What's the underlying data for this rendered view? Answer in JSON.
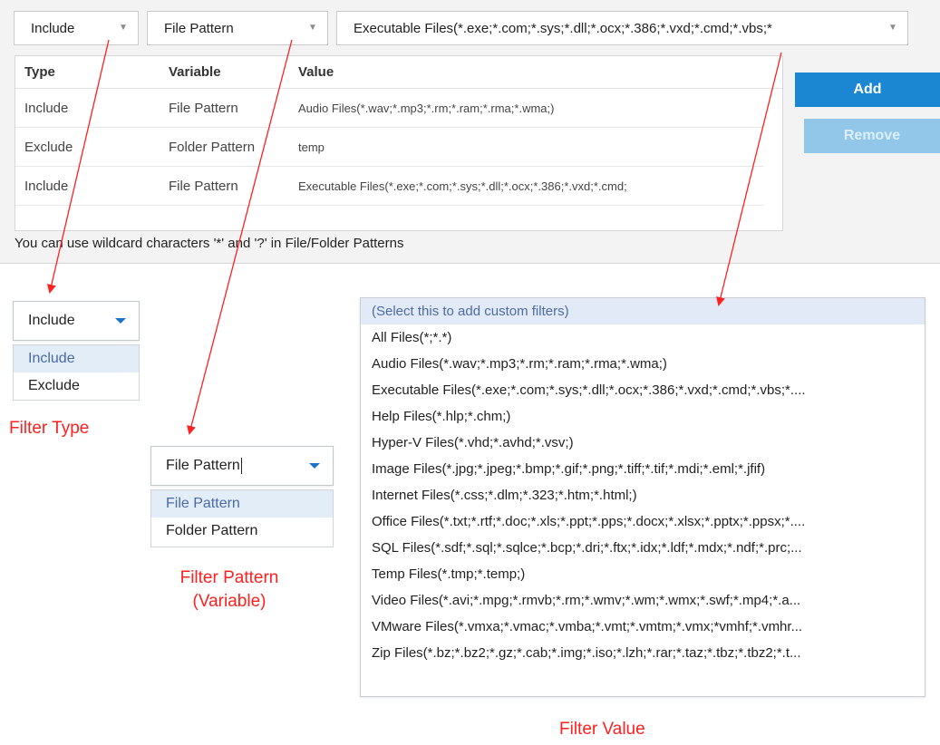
{
  "toolbar": {
    "type_combo": "Include",
    "variable_combo": "File Pattern",
    "value_combo": "Executable Files(*.exe;*.com;*.sys;*.dll;*.ocx;*.386;*.vxd;*.cmd;*.vbs;*"
  },
  "grid": {
    "headers": [
      "Type",
      "Variable",
      "Value"
    ],
    "rows": [
      {
        "type": "Include",
        "variable": "File Pattern",
        "value": "Audio Files(*.wav;*.mp3;*.rm;*.ram;*.rma;*.wma;)"
      },
      {
        "type": "Exclude",
        "variable": "Folder Pattern",
        "value": "temp"
      },
      {
        "type": "Include",
        "variable": "File Pattern",
        "value": "Executable Files(*.exe;*.com;*.sys;*.dll;*.ocx;*.386;*.vxd;*.cmd;"
      }
    ],
    "hint": "You can use wildcard characters '*' and '?' in File/Folder Patterns"
  },
  "buttons": {
    "add": "Add",
    "remove": "Remove"
  },
  "filter_type": {
    "selected": "Include",
    "options": [
      "Include",
      "Exclude"
    ],
    "caption": "Filter Type"
  },
  "filter_pattern": {
    "selected": "File Pattern",
    "options": [
      "File Pattern",
      "Folder Pattern"
    ],
    "caption_line1": "Filter Pattern",
    "caption_line2": "(Variable)"
  },
  "filter_value": {
    "options": [
      "(Select this to add custom filters)",
      "All Files(*;*.*)",
      "Audio Files(*.wav;*.mp3;*.rm;*.ram;*.rma;*.wma;)",
      "Executable Files(*.exe;*.com;*.sys;*.dll;*.ocx;*.386;*.vxd;*.cmd;*.vbs;*....",
      "Help Files(*.hlp;*.chm;)",
      "Hyper-V Files(*.vhd;*.avhd;*.vsv;)",
      "Image Files(*.jpg;*.jpeg;*.bmp;*.gif;*.png;*.tiff;*.tif;*.mdi;*.eml;*.jfif)",
      "Internet Files(*.css;*.dlm;*.323;*.htm;*.html;)",
      "Office Files(*.txt;*.rtf;*.doc;*.xls;*.ppt;*.pps;*.docx;*.xlsx;*.pptx;*.ppsx;*....",
      "SQL Files(*.sdf;*.sql;*.sqlce;*.bcp;*.dri;*.ftx;*.idx;*.ldf;*.mdx;*.ndf;*.prc;...",
      "Temp Files(*.tmp;*.temp;)",
      "Video Files(*.avi;*.mpg;*.rmvb;*.rm;*.wmv;*.wm;*.wmx;*.swf;*.mp4;*.a...",
      "VMware Files(*.vmxa;*.vmac;*.vmba;*.vmt;*.vmtm;*.vmx;*vmhf;*.vmhr...",
      "Zip Files(*.bz;*.bz2;*.gz;*.cab;*.img;*.iso;*.lzh;*.rar;*.taz;*.tbz;*.tbz2;*.t..."
    ],
    "caption": "Filter Value"
  },
  "colors": {
    "accent": "#1b86d1",
    "annotation": "#ff2020",
    "selected_bg": "#e3edf7"
  }
}
